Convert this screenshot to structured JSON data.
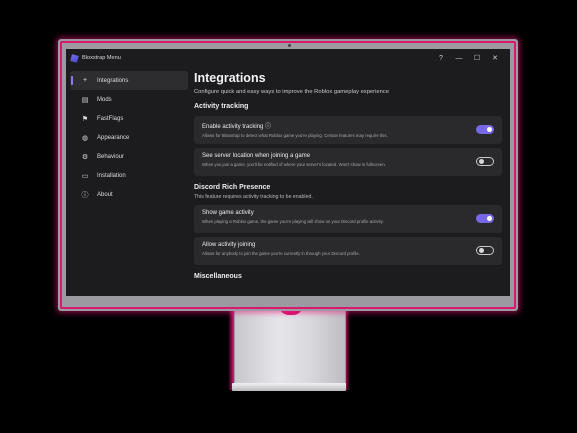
{
  "window": {
    "title": "Bloxstrap Menu",
    "help_label": "?",
    "minimize_label": "—",
    "maximize_label": "☐",
    "close_label": "✕"
  },
  "sidebar": {
    "items": [
      {
        "label": "Integrations",
        "icon": "plus-icon",
        "glyph": "+"
      },
      {
        "label": "Mods",
        "icon": "puzzle-icon",
        "glyph": "▤"
      },
      {
        "label": "FastFlags",
        "icon": "flag-icon",
        "glyph": "⚑"
      },
      {
        "label": "Appearance",
        "icon": "brush-icon",
        "glyph": "◍"
      },
      {
        "label": "Behaviour",
        "icon": "gear-icon",
        "glyph": "⚙"
      },
      {
        "label": "Installation",
        "icon": "drive-icon",
        "glyph": "▭"
      },
      {
        "label": "About",
        "icon": "info-icon",
        "glyph": "ⓘ"
      }
    ]
  },
  "content": {
    "title": "Integrations",
    "subtitle": "Configure quick and easy ways to improve the Roblox gameplay experience",
    "activity": {
      "heading": "Activity tracking",
      "cards": [
        {
          "title": "Enable activity tracking ⓘ",
          "desc": "Allows for Bloxstrap to detect what Roblox game you're playing. Certain features may require this.",
          "state": "on"
        },
        {
          "title": "See server location when joining a game",
          "desc": "When you join a game, you'll be notified of where your server's located. Won't show in fullscreen.",
          "state": "off"
        }
      ]
    },
    "discord": {
      "heading": "Discord Rich Presence",
      "desc": "This feature requires activity tracking to be enabled.",
      "cards": [
        {
          "title": "Show game activity",
          "desc": "When playing a Roblox game, the game you're playing will show on your Discord profile activity.",
          "state": "on"
        },
        {
          "title": "Allow activity joining",
          "desc": "Allows for anybody to join the game you're currently in through your Discord profile.",
          "state": "off"
        }
      ]
    },
    "misc": {
      "heading": "Miscellaneous"
    }
  },
  "colors": {
    "accent": "#7768e8",
    "glow": "#e01a7a",
    "window_bg": "#1c1c1e",
    "card_bg": "#2a2a2c"
  }
}
